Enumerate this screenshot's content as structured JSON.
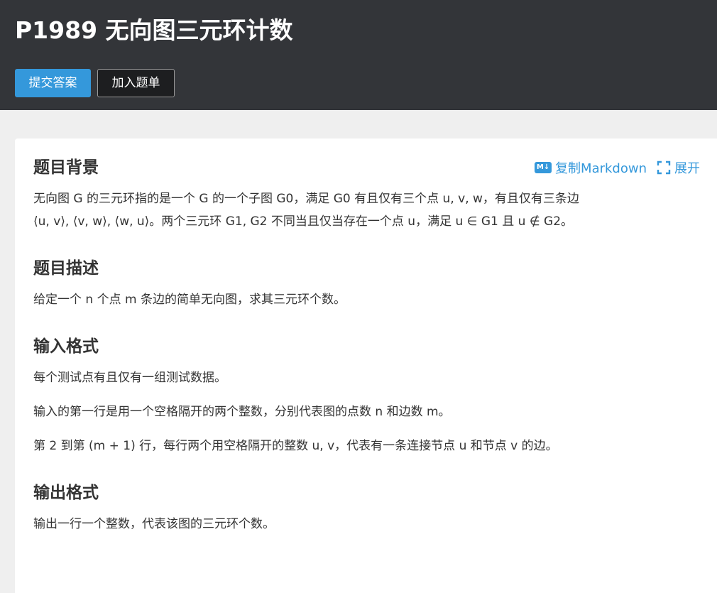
{
  "header": {
    "title": "P1989 无向图三元环计数",
    "submit_label": "提交答案",
    "add_list_label": "加入题单"
  },
  "tools": {
    "copy_markdown": "复制Markdown",
    "expand": "展开",
    "md_icon": "M↓"
  },
  "sections": {
    "background": {
      "title": "题目背景",
      "line1": "无向图 G 的三元环指的是一个 G 的一个子图 G0，满足 G0 有且仅有三个点 u, v, w，有且仅有三条边",
      "line2": "⟨u, v⟩, ⟨v, w⟩, ⟨w, u⟩。两个三元环 G1, G2 不同当且仅当存在一个点 u，满足 u ∈ G1 且 u ∉ G2。"
    },
    "description": {
      "title": "题目描述",
      "text": "给定一个 n 个点 m 条边的简单无向图，求其三元环个数。"
    },
    "input": {
      "title": "输入格式",
      "p1": "每个测试点有且仅有一组测试数据。",
      "p2": "输入的第一行是用一个空格隔开的两个整数，分别代表图的点数 n 和边数 m。",
      "p3": "第 2 到第 (m + 1) 行，每行两个用空格隔开的整数 u, v，代表有一条连接节点 u 和节点 v 的边。"
    },
    "output": {
      "title": "输出格式",
      "text": "输出一行一个整数，代表该图的三元环个数。"
    }
  },
  "colors": {
    "header_bg": "#333539",
    "accent": "#3498db",
    "page_bg": "#efefef"
  }
}
